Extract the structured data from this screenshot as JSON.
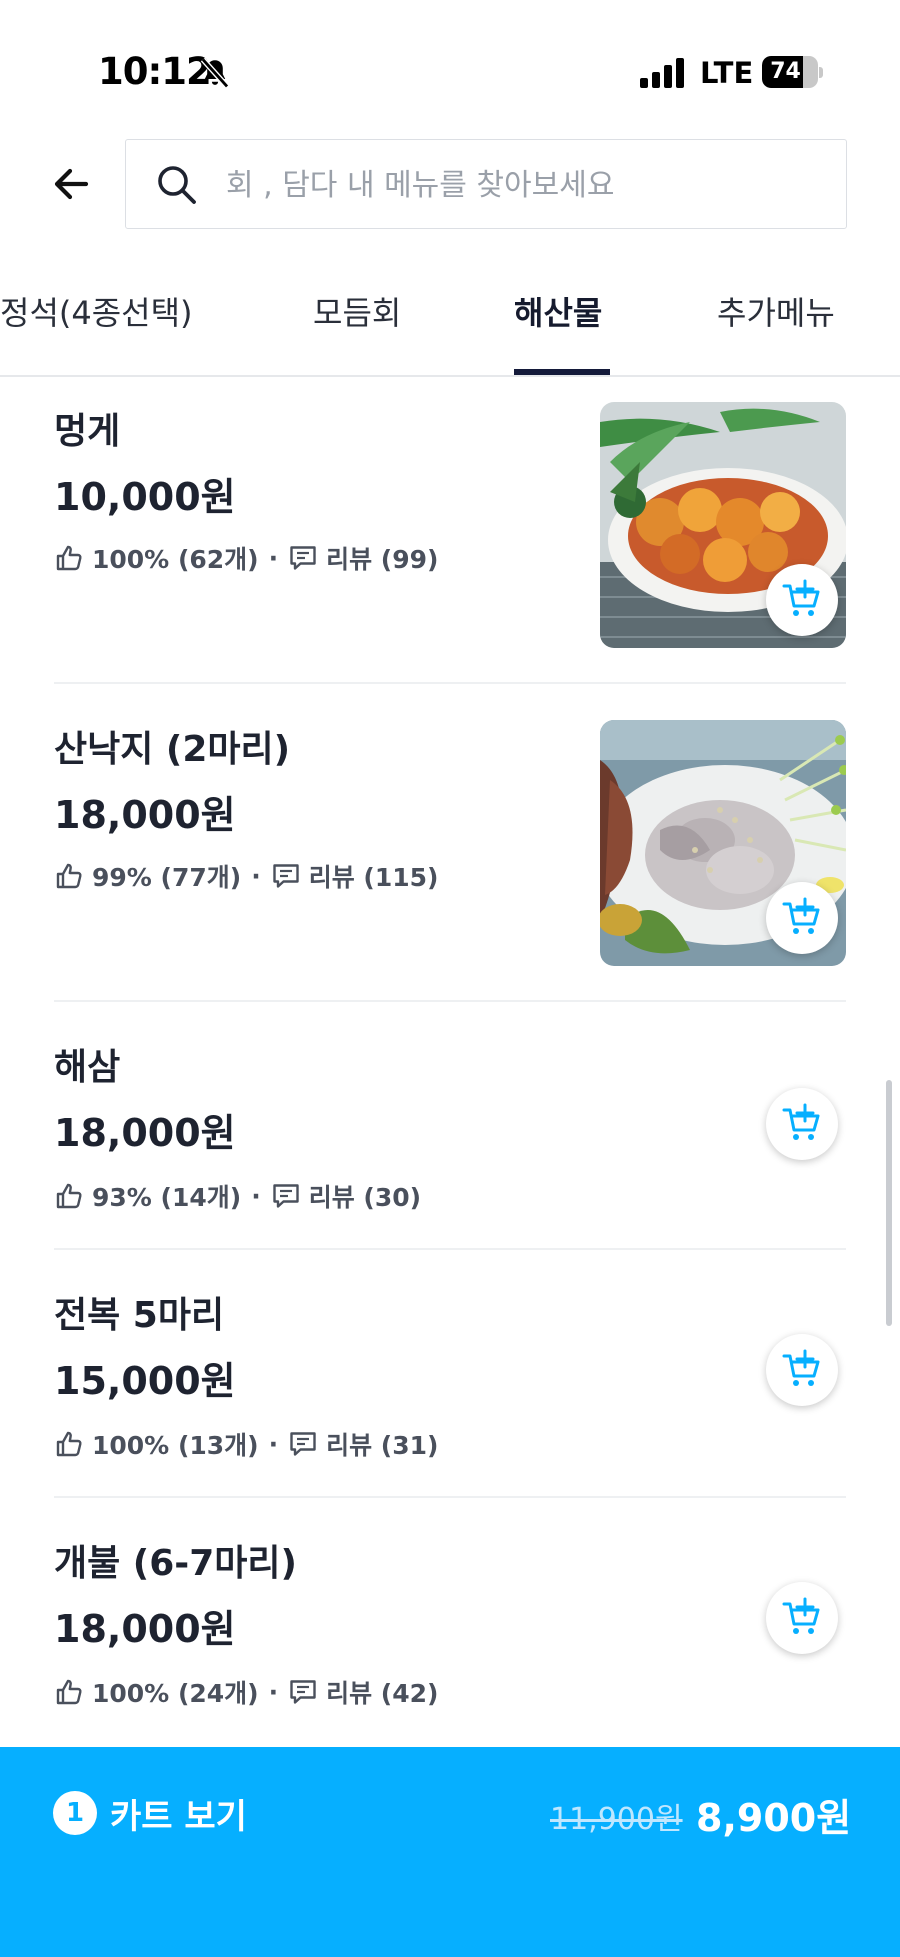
{
  "status_bar": {
    "time": "10:12",
    "network": "LTE",
    "battery": "74",
    "battery_level": 0.74
  },
  "search": {
    "placeholder": "회 , 담다 내 메뉴를 찾아보세요"
  },
  "tabs": [
    {
      "label": "정석(4종선택)",
      "active": false
    },
    {
      "label": "모듬회",
      "active": false
    },
    {
      "label": "해산물",
      "active": true
    },
    {
      "label": "추가메뉴",
      "active": false
    }
  ],
  "items": [
    {
      "name": "멍게",
      "price": "10,000원",
      "likes": "100% (62개)",
      "reviews": "리뷰 (99)",
      "has_photo": true
    },
    {
      "name": "산낙지 (2마리)",
      "price": "18,000원",
      "likes": "99% (77개)",
      "reviews": "리뷰 (115)",
      "has_photo": true
    },
    {
      "name": "해삼",
      "price": "18,000원",
      "likes": "93% (14개)",
      "reviews": "리뷰 (30)",
      "has_photo": false
    },
    {
      "name": "전복 5마리",
      "price": "15,000원",
      "likes": "100% (13개)",
      "reviews": "리뷰 (31)",
      "has_photo": false
    },
    {
      "name": "개불 (6-7마리)",
      "price": "18,000원",
      "likes": "100% (24개)",
      "reviews": "리뷰 (42)",
      "has_photo": false
    }
  ],
  "cart": {
    "count": "1",
    "label": "카트 보기",
    "original_price": "11,900원",
    "total_price": "8,900원"
  },
  "colors": {
    "accent": "#06afff",
    "tab_indicator": "#141a3a",
    "text": "#1e2330"
  },
  "icons": {
    "back": "arrow-left-icon",
    "search": "search-icon",
    "like": "thumbs-up-icon",
    "review": "comment-icon",
    "add_to_cart": "cart-plus-icon"
  }
}
